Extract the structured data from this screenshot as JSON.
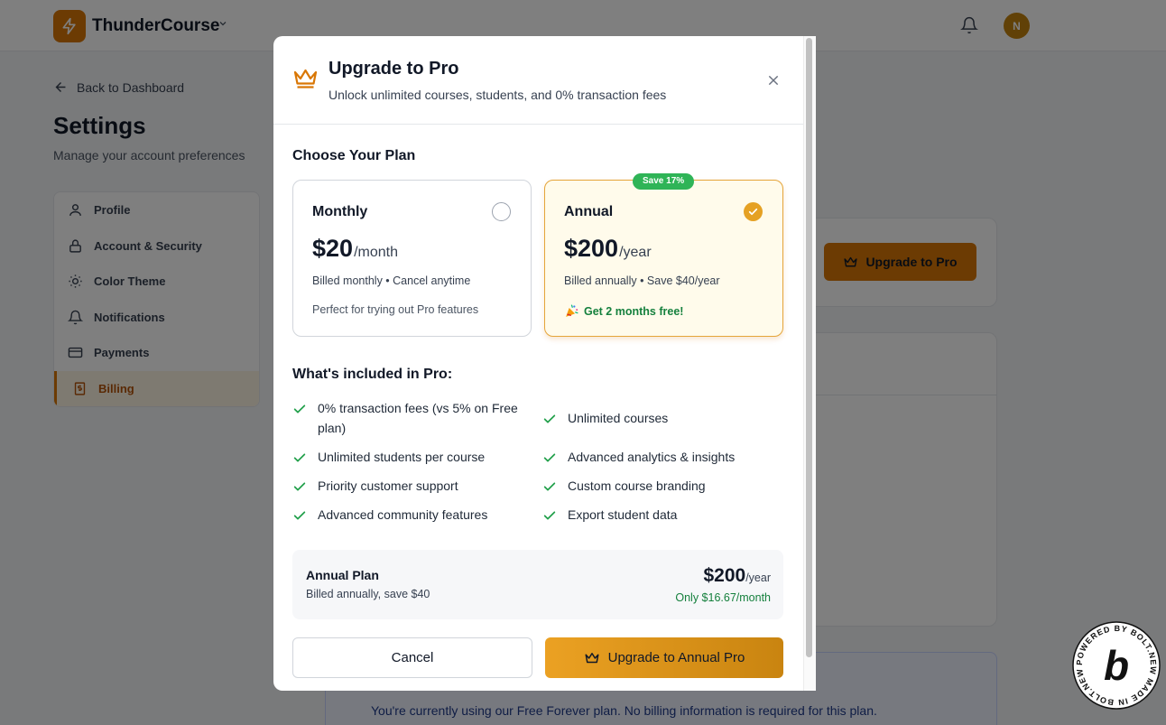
{
  "app": {
    "brand": "ThunderCourse",
    "avatar_initial": "N"
  },
  "page": {
    "back_label": "Back to Dashboard",
    "title": "Settings",
    "subtitle": "Manage your account preferences"
  },
  "sidebar": {
    "items": [
      {
        "label": "Profile",
        "icon": "user-icon"
      },
      {
        "label": "Account & Security",
        "icon": "lock-icon"
      },
      {
        "label": "Color Theme",
        "icon": "sun-icon"
      },
      {
        "label": "Notifications",
        "icon": "bell-icon"
      },
      {
        "label": "Payments",
        "icon": "credit-card-icon"
      },
      {
        "label": "Billing",
        "icon": "receipt-dollar-icon",
        "active": true
      }
    ]
  },
  "background": {
    "upgrade_button": "Upgrade to Pro",
    "info_text": "You're currently using our Free Forever plan. No billing information is required for this plan."
  },
  "modal": {
    "title": "Upgrade to Pro",
    "subtitle": "Unlock unlimited courses, students, and 0% transaction fees",
    "choose_title": "Choose Your Plan",
    "plans": {
      "monthly": {
        "name": "Monthly",
        "price": "$20",
        "period": "/month",
        "note": "Billed monthly • Cancel anytime",
        "extra": "Perfect for trying out Pro features",
        "selected": false
      },
      "annual": {
        "name": "Annual",
        "price": "$200",
        "period": "/year",
        "note": "Billed annually • Save $40/year",
        "extra": "Get 2 months free!",
        "badge": "Save 17%",
        "selected": true
      }
    },
    "included_title": "What's included in Pro:",
    "features": [
      "0% transaction fees (vs 5% on Free plan)",
      "Unlimited courses",
      "Unlimited students per course",
      "Advanced analytics & insights",
      "Priority customer support",
      "Custom course branding",
      "Advanced community features",
      "Export student data"
    ],
    "summary": {
      "name": "Annual Plan",
      "note": "Billed annually, save $40",
      "price": "$200",
      "period": "/year",
      "monthly": "Only $16.67/month"
    },
    "cancel_label": "Cancel",
    "upgrade_label": "Upgrade to Annual Pro"
  },
  "colors": {
    "accent": "#d97706",
    "success": "#15803d",
    "badge": "#2fb457"
  }
}
